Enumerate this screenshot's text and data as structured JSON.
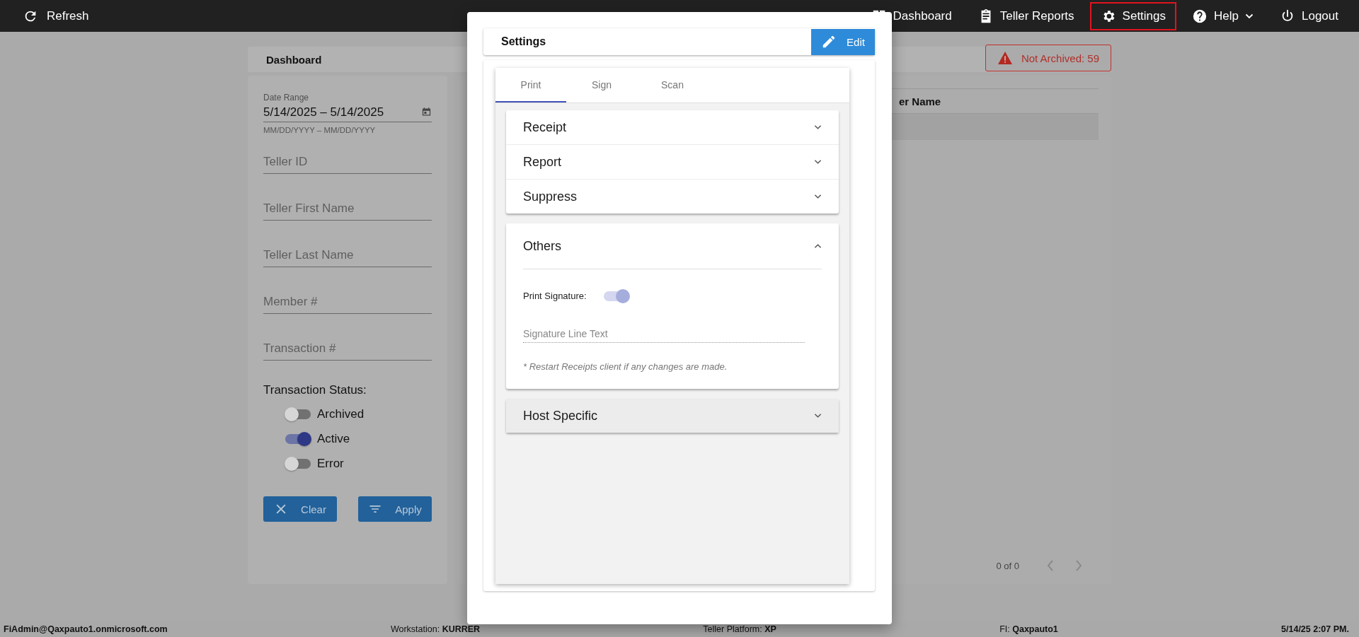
{
  "top_bar": {
    "refresh": "Refresh",
    "nav": [
      {
        "label": "Dashboard",
        "selected": false,
        "has_menu": false
      },
      {
        "label": "Teller Reports",
        "selected": false,
        "has_menu": false
      },
      {
        "label": "Settings",
        "selected": true,
        "has_menu": false
      },
      {
        "label": "Help",
        "selected": false,
        "has_menu": true
      },
      {
        "label": "Logout",
        "selected": false,
        "has_menu": false
      }
    ]
  },
  "dashboard": {
    "title": "Dashboard",
    "alert": "Not Archived: 59",
    "filters": {
      "date_range": {
        "label": "Date Range",
        "value": "5/14/2025 – 5/14/2025",
        "hint": "MM/DD/YYYY – MM/DD/YYYY"
      },
      "fields": [
        {
          "placeholder": "Teller ID"
        },
        {
          "placeholder": "Teller First Name"
        },
        {
          "placeholder": "Teller Last Name"
        },
        {
          "placeholder": "Member #"
        },
        {
          "placeholder": "Transaction #"
        }
      ],
      "status_label": "Transaction Status:",
      "statuses": [
        {
          "label": "Archived",
          "on": false
        },
        {
          "label": "Active",
          "on": true
        },
        {
          "label": "Error",
          "on": false
        }
      ],
      "buttons": [
        {
          "label": "Clear"
        },
        {
          "label": "Apply"
        }
      ]
    },
    "table": {
      "columns": [
        "er Name"
      ],
      "pagination": "0 of 0"
    }
  },
  "settings_dialog": {
    "title": "Settings",
    "edit_button": "Edit",
    "tabs": [
      {
        "label": "Print",
        "selected": true
      },
      {
        "label": "Sign",
        "selected": false
      },
      {
        "label": "Scan",
        "selected": false
      }
    ],
    "sections": [
      {
        "title": "Receipt",
        "expanded": false,
        "hovered": false
      },
      {
        "title": "Report",
        "expanded": false,
        "hovered": false
      },
      {
        "title": "Suppress",
        "expanded": false,
        "hovered": false
      },
      {
        "title": "Others",
        "expanded": true,
        "hovered": false,
        "print_signature": {
          "label": "Print Signature:",
          "on": true,
          "disabled": true
        },
        "signature_line": {
          "placeholder": "Signature Line Text",
          "disabled": true
        },
        "note": "* Restart Receipts client if any changes are made."
      },
      {
        "title": "Host Specific",
        "expanded": false,
        "hovered": true
      }
    ]
  },
  "status_bar": {
    "user": "FiAdmin@Qaxpauto1.onmicrosoft.com",
    "items": [
      {
        "label": "Workstation:",
        "value": "KURRER"
      },
      {
        "label": "Teller Platform:",
        "value": "XP"
      },
      {
        "label": "FI:",
        "value": "Qaxpauto1"
      }
    ],
    "datetime": "5/14/25 2:07 PM."
  }
}
